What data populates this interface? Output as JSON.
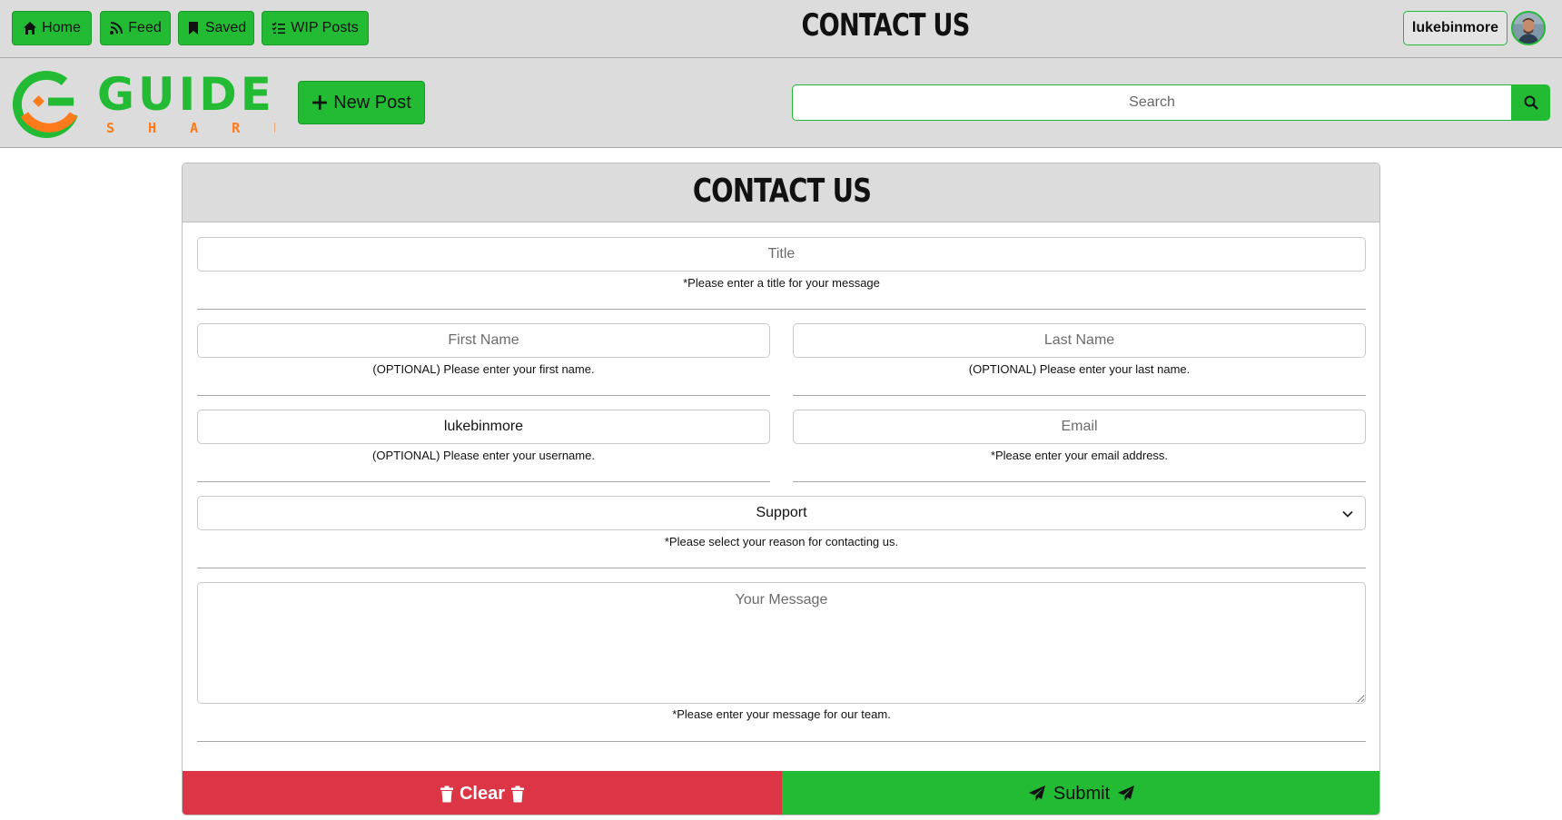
{
  "nav": {
    "home": "Home",
    "feed": "Feed",
    "saved": "Saved",
    "wip": "WIP Posts",
    "page_title": "CONTACT US",
    "username": "lukebinmore"
  },
  "subbar": {
    "logo_word": "GUIDE",
    "logo_sub": "S H A R E",
    "new_post": "New Post",
    "search_placeholder": "Search"
  },
  "form": {
    "heading": "CONTACT US",
    "title_placeholder": "Title",
    "title_help": "*Please enter a title for your message",
    "first_name_placeholder": "First Name",
    "first_name_help": "(OPTIONAL) Please enter your first name.",
    "last_name_placeholder": "Last Name",
    "last_name_help": "(OPTIONAL) Please enter your last name.",
    "username_value": "lukebinmore",
    "username_help": "(OPTIONAL) Please enter your username.",
    "email_placeholder": "Email",
    "email_help": "*Please enter your email address.",
    "reason_selected": "Support",
    "reason_help": "*Please select your reason for contacting us.",
    "message_placeholder": "Your Message",
    "message_help": "*Please enter your message for our team.",
    "clear_label": "Clear",
    "submit_label": "Submit"
  },
  "colors": {
    "brand_green": "#22bb33",
    "danger_red": "#dc3545",
    "logo_orange": "#ff7a1a",
    "bar_grey": "#dcdcdc"
  }
}
